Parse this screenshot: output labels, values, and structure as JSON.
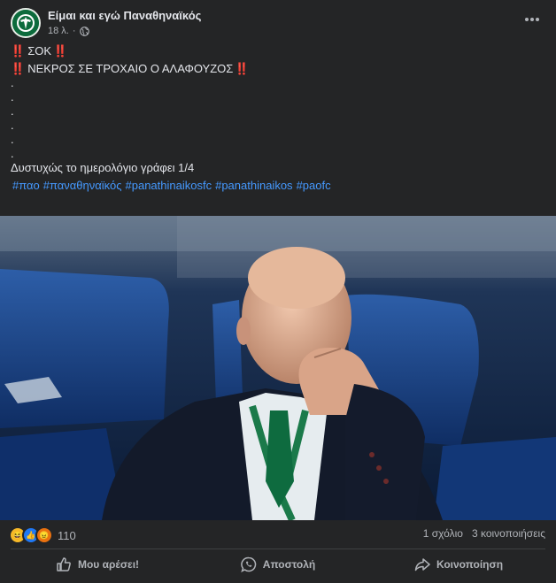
{
  "post": {
    "page_name": "Είμαι και εγώ Παναθηναϊκός",
    "time": "18 λ.",
    "audience_icon": "globe-icon",
    "more_icon": "more-horizontal-icon"
  },
  "content": {
    "line1_marker": "‼️",
    "line1_text": "ΣΟΚ",
    "line1_marker_end": "‼️",
    "line2_marker": "‼️",
    "line2_text": "ΝΕΚΡΟΣ ΣΕ ΤΡΟΧΑΙΟ Ο ΑΛΑΦΟΥΖΟΣ",
    "line2_marker_end": "‼️",
    "dots": [
      ".",
      ".",
      ".",
      ".",
      ".",
      "."
    ],
    "final_text": "Δυστυχώς το ημερολόγιο γράφει 1/4",
    "hashtags": [
      "#παο",
      "#παναθηναϊκός",
      "#panathinaikosfc",
      "#panathinaikos",
      "#paofc"
    ]
  },
  "stats": {
    "reactions_count": "110",
    "reaction_icons": [
      "haha-reaction-icon",
      "like-reaction-icon",
      "angry-reaction-icon"
    ],
    "comments": "1 σχόλιο",
    "shares": "3 κοινοποιήσεις"
  },
  "actions": {
    "like": "Μου αρέσει!",
    "send": "Αποστολή",
    "share": "Κοινοποίηση"
  },
  "colors": {
    "background": "#242526",
    "hashtag": "#4599ff",
    "alert": "#e41e3f",
    "secondary_text": "#b0b3b8"
  }
}
